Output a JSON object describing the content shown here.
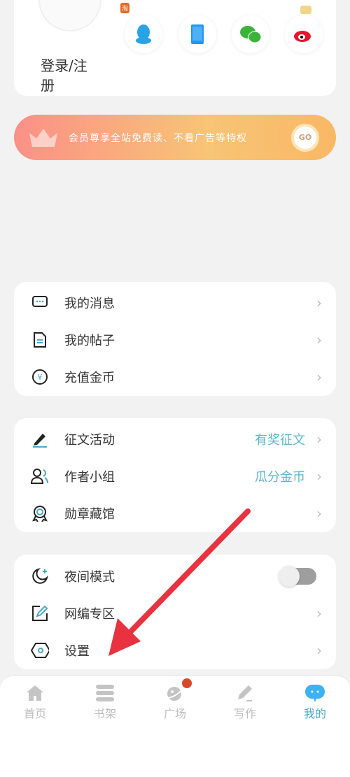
{
  "profile": {
    "login_label": "登录/注册",
    "social": [
      {
        "name": "qq",
        "badge": "淘"
      },
      {
        "name": "phone"
      },
      {
        "name": "wechat"
      },
      {
        "name": "weibo"
      }
    ]
  },
  "banner": {
    "text": "会员尊享全站免费读、不看广告等特权",
    "go": "GO"
  },
  "group1": [
    {
      "icon": "message-icon",
      "label": "我的消息"
    },
    {
      "icon": "post-icon",
      "label": "我的帖子"
    },
    {
      "icon": "coin-icon",
      "label": "充值金币"
    }
  ],
  "group2": [
    {
      "icon": "pen-icon",
      "label": "征文活动",
      "extra": "有奖征文"
    },
    {
      "icon": "users-icon",
      "label": "作者小组",
      "extra": "瓜分金币"
    },
    {
      "icon": "medal-icon",
      "label": "勋章藏馆"
    }
  ],
  "group3": [
    {
      "icon": "moon-icon",
      "label": "夜间模式",
      "toggle": false
    },
    {
      "icon": "edit-icon",
      "label": "网编专区"
    },
    {
      "icon": "settings-icon",
      "label": "设置"
    }
  ],
  "nav": [
    {
      "label": "首页",
      "icon": "home-icon"
    },
    {
      "label": "书架",
      "icon": "bookshelf-icon"
    },
    {
      "label": "广场",
      "icon": "planet-icon",
      "dot": true
    },
    {
      "label": "写作",
      "icon": "write-icon"
    },
    {
      "label": "我的",
      "icon": "chat-bubble-icon",
      "active": true
    }
  ],
  "colors": {
    "accent": "#4aa9c8",
    "annotation_arrow": "#e8323f"
  }
}
